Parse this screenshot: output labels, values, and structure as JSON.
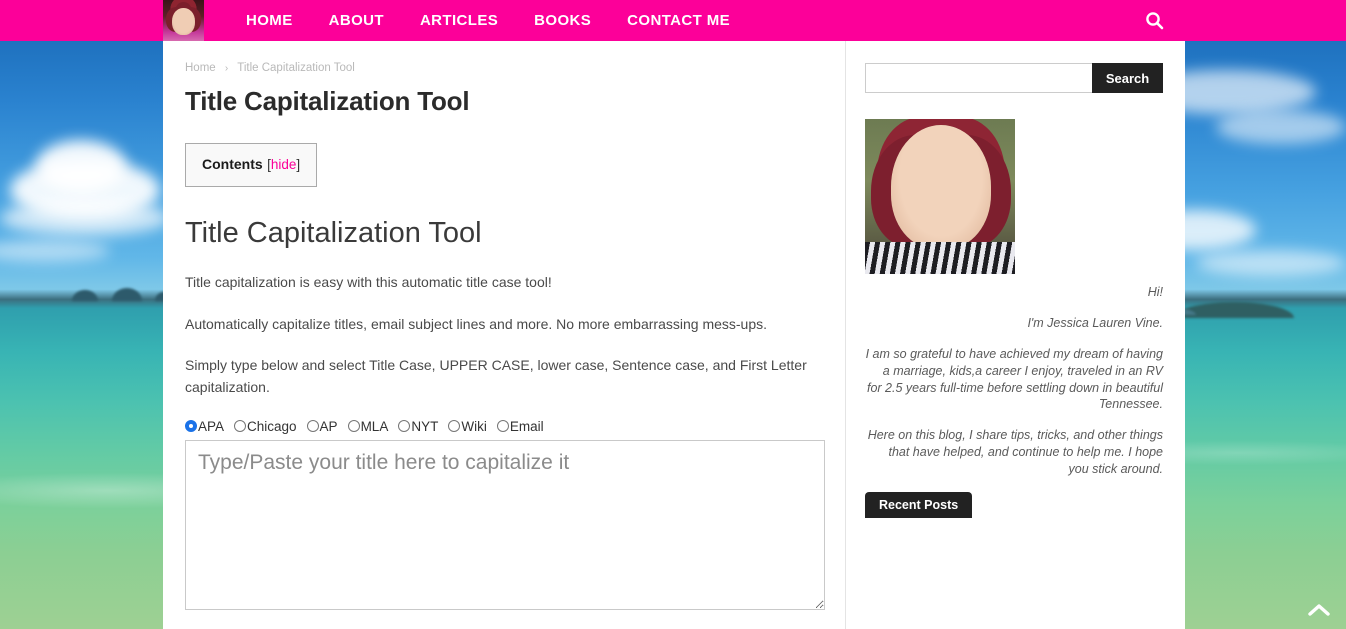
{
  "site": {
    "brand_pink": "#fc0099",
    "nav": [
      {
        "label": "HOME"
      },
      {
        "label": "ABOUT"
      },
      {
        "label": "ARTICLES"
      },
      {
        "label": "BOOKS"
      },
      {
        "label": "CONTACT ME"
      }
    ],
    "search_icon": "search-icon",
    "logo_icon": "author-avatar-logo"
  },
  "breadcrumb": {
    "home": "Home",
    "separator": "›",
    "current": "Title Capitalization Tool"
  },
  "page": {
    "title": "Title Capitalization Tool"
  },
  "toc": {
    "label": "Contents",
    "bracket_open": "[",
    "hide": "hide",
    "bracket_close": "]"
  },
  "article": {
    "heading": "Title Capitalization Tool",
    "paragraphs": [
      "Title capitalization is easy with this automatic title case tool!",
      "Automatically capitalize titles, email subject lines and more. No more embarrassing mess-ups.",
      "Simply type below and select Title Case, UPPER CASE, lower case, Sentence case, and First Letter capitalization."
    ]
  },
  "style_options": [
    {
      "label": "APA",
      "checked": true
    },
    {
      "label": "Chicago",
      "checked": false
    },
    {
      "label": "AP",
      "checked": false
    },
    {
      "label": "MLA",
      "checked": false
    },
    {
      "label": "NYT",
      "checked": false
    },
    {
      "label": "Wiki",
      "checked": false
    },
    {
      "label": "Email",
      "checked": false
    }
  ],
  "title_input": {
    "value": "",
    "placeholder": "Type/Paste your title here to capitalize it"
  },
  "sidebar": {
    "search": {
      "value": "",
      "placeholder": "",
      "button_label": "Search"
    },
    "author_photo_alt": "author-portrait",
    "bio": [
      "Hi!",
      "I'm Jessica Lauren Vine.",
      "I am so grateful to have achieved my dream of having a marriage, kids,a career I enjoy, traveled in an RV for 2.5 years full-time before settling down in beautiful Tennessee.",
      "Here on this blog, I share tips, tricks, and other things that have helped, and continue to help me. I hope you stick around."
    ],
    "recent_posts_tab": "Recent Posts"
  },
  "scroll_top": {
    "icon": "chevron-up-icon"
  }
}
